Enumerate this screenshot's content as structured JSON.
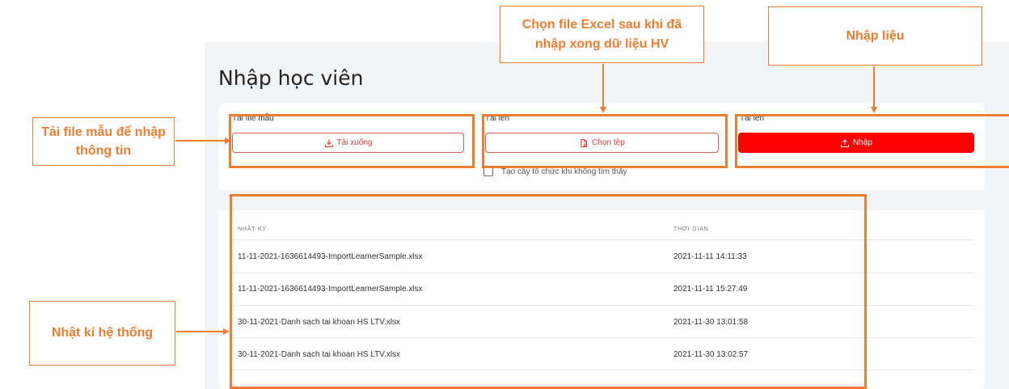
{
  "page": {
    "title": "Nhập học viên"
  },
  "upload": {
    "template": {
      "label": "Tải file mẫu",
      "button": "Tải xuống",
      "icon": "download-icon"
    },
    "choose": {
      "label": "Tải lên",
      "button": "Chọn tệp",
      "icon": "file-icon"
    },
    "import": {
      "label": "Tải lên",
      "button": "Nhập",
      "icon": "upload-icon"
    },
    "checkbox_label": "Tạo cây tổ chức khi không tìm thấy",
    "checkbox_checked": false
  },
  "log_table": {
    "headers": [
      "NHẬT KÝ",
      "THỜI GIAN"
    ],
    "rows": [
      {
        "file": "11-11-2021-1636614493-ImportLearnerSample.xlsx",
        "time": "2021-11-11 14:11:33"
      },
      {
        "file": "11-11-2021-1636614493-ImportLearnerSample.xlsx",
        "time": "2021-11-11 15:27:49"
      },
      {
        "file": "30-11-2021-Danh sach tai khoan HS LTV.xlsx",
        "time": "2021-11-30 13:01:58"
      },
      {
        "file": "30-11-2021-Danh sach tai khoan HS LTV.xlsx",
        "time": "2021-11-30 13:02:57"
      }
    ]
  },
  "annotations": {
    "template_note": "Tải file mẫu để nhập thông tin",
    "choose_note": "Chọn file Excel sau khi đã nhập xong dữ liệu HV",
    "import_note": "Nhập liệu",
    "log_note": "Nhật kí hệ thống",
    "color": "#ed7d31"
  },
  "colors": {
    "primary_red": "#ff0000",
    "outline_red": "#e53935"
  }
}
